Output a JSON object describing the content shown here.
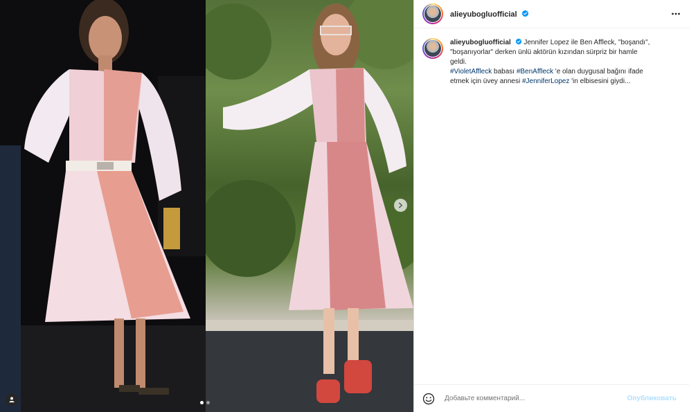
{
  "post": {
    "username": "alieyubogluofficial",
    "verified": true,
    "caption_lines": [
      "Jennifer Lopez ile Ben Affleck, \"boşandı\",",
      "\"boşanıyorlar\" derken ünlü aktörün kızından sürpriz bir hamle",
      "geldi."
    ],
    "caption_second": {
      "hashtag1": "#VioletAffleck",
      "text1": " babası ",
      "hashtag2": "#BenAffleck",
      "text2": " 'e olan duygusal bağını ifade",
      "text3": "etmek için üvey annesi ",
      "hashtag3": "#JenniferLopez",
      "text4": " 'in elbisesini giydi..."
    }
  },
  "comment": {
    "placeholder": "Добавьте комментарий...",
    "publish_label": "Опубликовать"
  },
  "carousel": {
    "total": 2,
    "current": 1
  },
  "icons": {
    "verified": "verified-badge-icon",
    "more": "more-options-icon",
    "next": "chevron-right-icon",
    "emoji": "emoji-icon",
    "tag": "user-tag-icon"
  },
  "colors": {
    "hashtag": "#00376b",
    "verified": "#0095f6",
    "publish_disabled": "#b2dffc"
  }
}
